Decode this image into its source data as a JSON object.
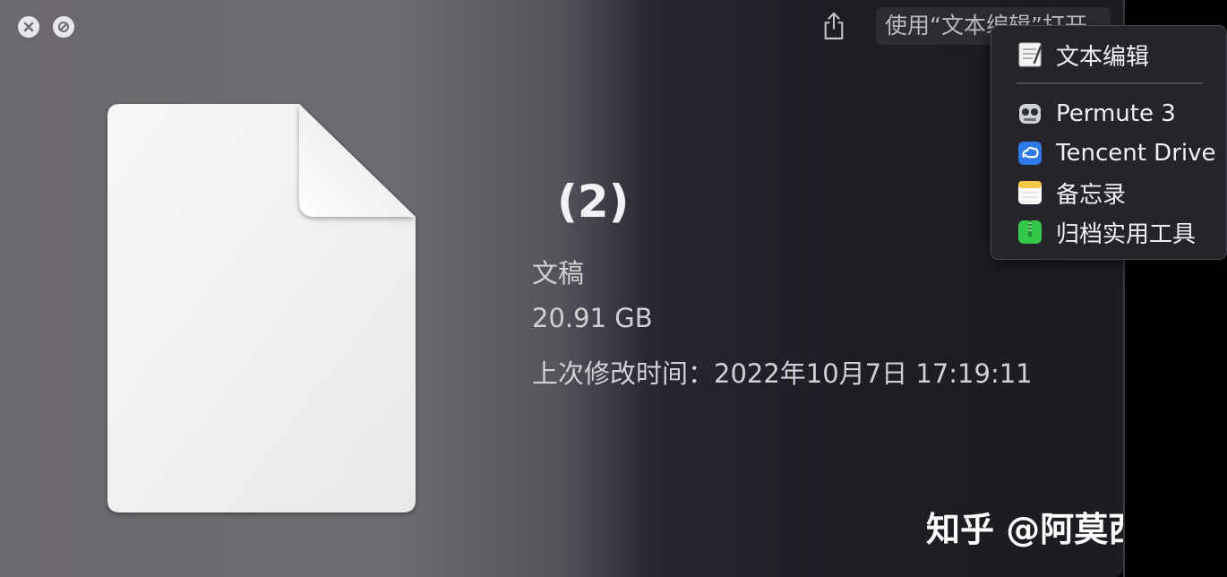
{
  "titlebar": {
    "close_icon": "close-icon",
    "fullscreen_icon": "no-entry-icon",
    "share_icon": "share-icon",
    "open_with_label": "使用“文本编辑”打开"
  },
  "file": {
    "name": "(2)",
    "kind": "文稿",
    "size": "20.91 GB",
    "modified": "上次修改时间：2022年10月7日 17:19:11"
  },
  "menu": {
    "items": [
      {
        "label": "文本编辑",
        "icon": "textedit-icon"
      },
      {
        "label": "Permute 3",
        "icon": "permute-icon"
      },
      {
        "label": "Tencent Drive",
        "icon": "tencent-drive-icon"
      },
      {
        "label": "备忘录",
        "icon": "notes-icon"
      },
      {
        "label": "归档实用工具",
        "icon": "archive-utility-icon"
      }
    ]
  },
  "watermark": "知乎 @阿莫西林",
  "colors": {
    "window_bg_left": "#6e6b72",
    "window_bg_right": "#1e1b22",
    "menu_bg": "#26232a",
    "text_primary": "#f2f2f4",
    "text_secondary": "#d2cfd6"
  }
}
